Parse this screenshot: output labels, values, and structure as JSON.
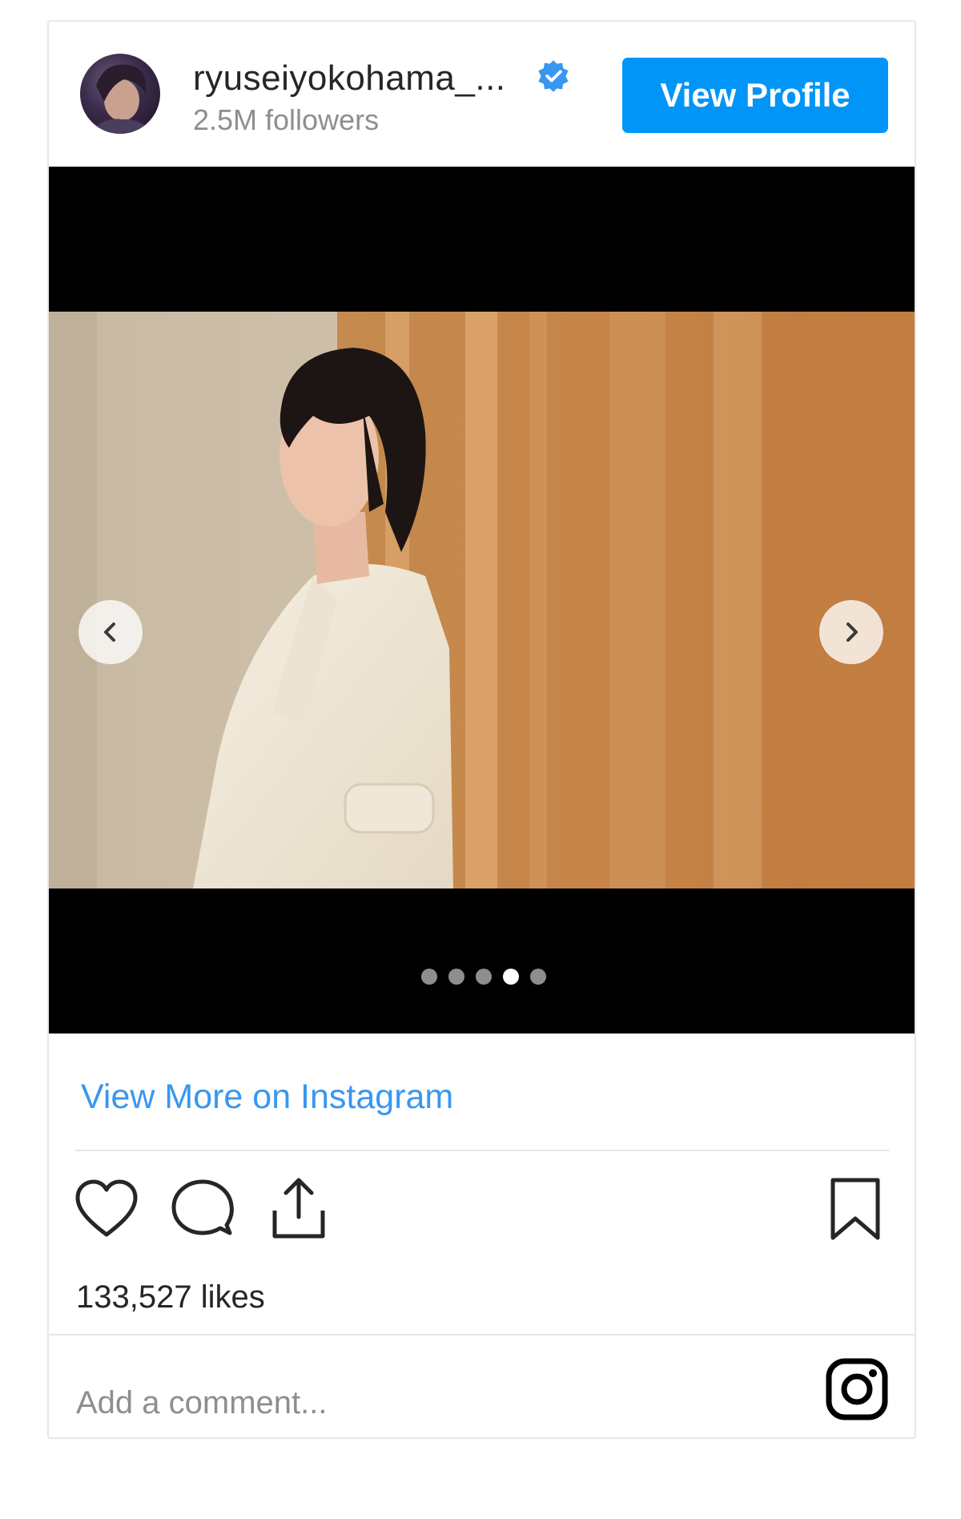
{
  "header": {
    "username": "ryuseiyokohama_...",
    "verified_icon": "verified-badge-icon",
    "followers": "2.5M followers",
    "view_profile_label": "View Profile"
  },
  "media": {
    "slide_count": 5,
    "active_slide_index": 3,
    "prev_icon": "chevron-left-icon",
    "next_icon": "chevron-right-icon"
  },
  "links": {
    "view_more": "View More on Instagram"
  },
  "actions": {
    "like_icon": "heart-icon",
    "comment_icon": "comment-bubble-icon",
    "share_icon": "share-upload-icon",
    "save_icon": "bookmark-icon"
  },
  "likes": "133,527 likes",
  "comment": {
    "placeholder": "Add a comment..."
  },
  "colors": {
    "accent": "#0095f6",
    "link": "#3897f0",
    "text": "#262626",
    "muted": "#8e8e8e"
  }
}
